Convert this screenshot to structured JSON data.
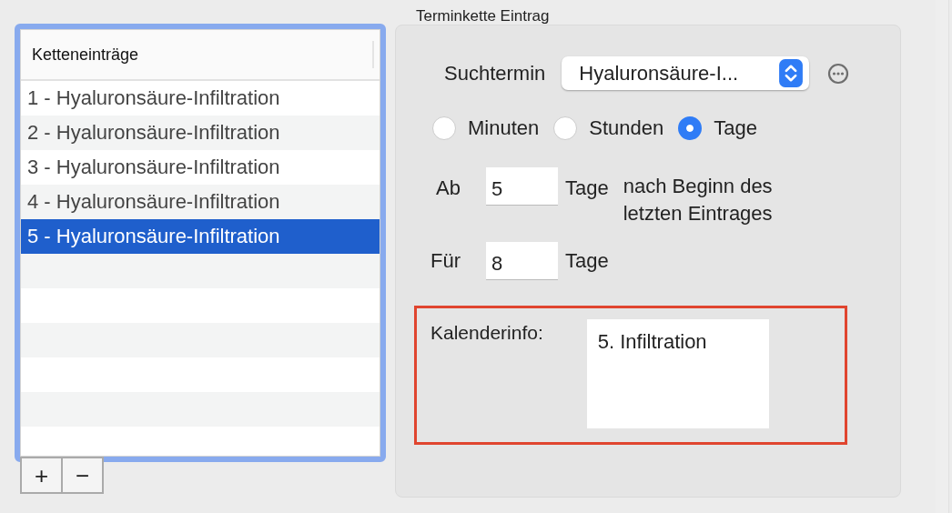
{
  "entries_list": {
    "header": "Ketteneinträge",
    "focused": true,
    "items": [
      {
        "label": "1 - Hyaluronsäure-Infiltration",
        "selected": false
      },
      {
        "label": "2 - Hyaluronsäure-Infiltration",
        "selected": false
      },
      {
        "label": "3 - Hyaluronsäure-Infiltration",
        "selected": false
      },
      {
        "label": "4 - Hyaluronsäure-Infiltration",
        "selected": false
      },
      {
        "label": "5 - Hyaluronsäure-Infiltration",
        "selected": true
      }
    ],
    "buttons": [
      "+",
      "−"
    ]
  },
  "entry_group": {
    "title": "Terminkette Eintrag",
    "search": {
      "label": "Suchtermin",
      "value": "Hyaluronsäure-I..."
    },
    "units": [
      {
        "label": "Minuten",
        "selected": false
      },
      {
        "label": "Stunden",
        "selected": false
      },
      {
        "label": "Tage",
        "selected": true
      }
    ],
    "from": {
      "label": "Ab",
      "value": "5",
      "unit": "Tage",
      "note": "nach Beginn des letzten Eintrages"
    },
    "duration": {
      "label": "Für",
      "value": "8",
      "unit": "Tage"
    },
    "calendar_info": {
      "label": "Kalenderinfo:",
      "value": "5. Infiltration",
      "highlighted": true
    }
  }
}
